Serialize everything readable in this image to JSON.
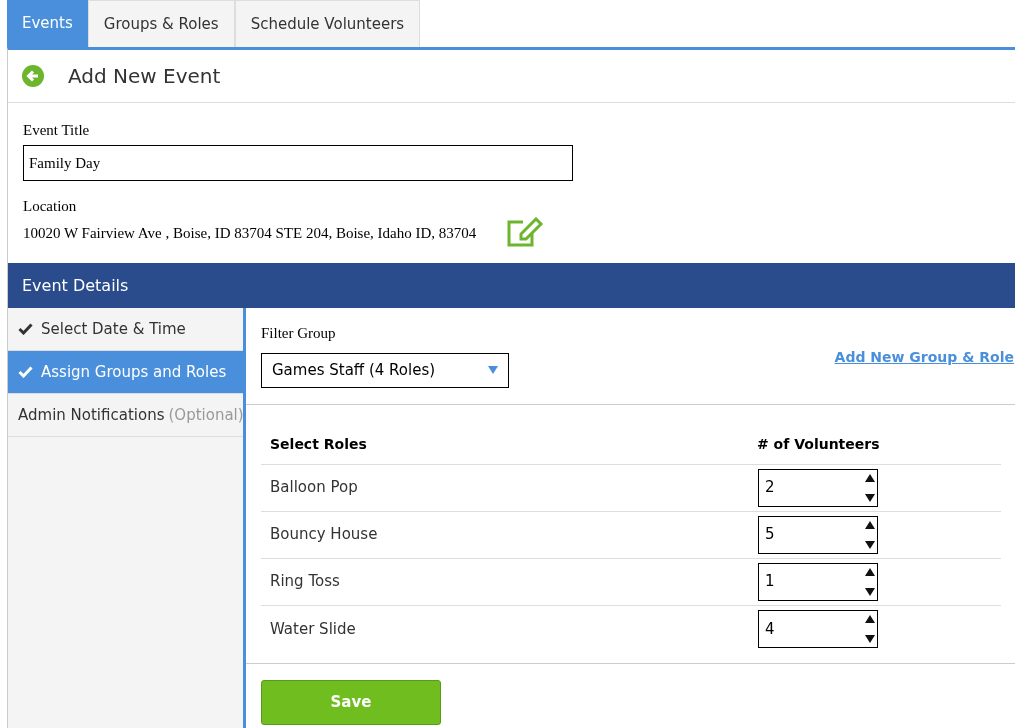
{
  "tabs": [
    {
      "label": "Events",
      "selected": true
    },
    {
      "label": "Groups & Roles",
      "selected": false
    },
    {
      "label": "Schedule Volunteers",
      "selected": false
    }
  ],
  "header": {
    "title": "Add New Event"
  },
  "form": {
    "title_label": "Event Title",
    "title_value": "Family Day",
    "location_label": "Location",
    "location_value": "10020 W Fairview Ave , Boise, ID 83704 STE 204, Boise, Idaho ID, 83704"
  },
  "section": {
    "title": "Event Details"
  },
  "steps": [
    {
      "label": "Select Date & Time",
      "checked": true,
      "selected": false
    },
    {
      "label": "Assign Groups and Roles",
      "checked": true,
      "selected": true
    },
    {
      "label": "Admin Notifications",
      "note": "(Optional)",
      "checked": false,
      "selected": false
    }
  ],
  "filter": {
    "label": "Filter Group",
    "value": "Games Staff (4 Roles)",
    "link": "Add New Group & Role"
  },
  "table": {
    "columns": [
      "Select Roles",
      "# of Volunteers"
    ],
    "rows": [
      {
        "role": "Balloon Pop",
        "volunteers": "2"
      },
      {
        "role": "Bouncy House",
        "volunteers": "5"
      },
      {
        "role": "Ring Toss",
        "volunteers": "1"
      },
      {
        "role": "Water Slide",
        "volunteers": "4"
      }
    ]
  },
  "save_button": "Save"
}
